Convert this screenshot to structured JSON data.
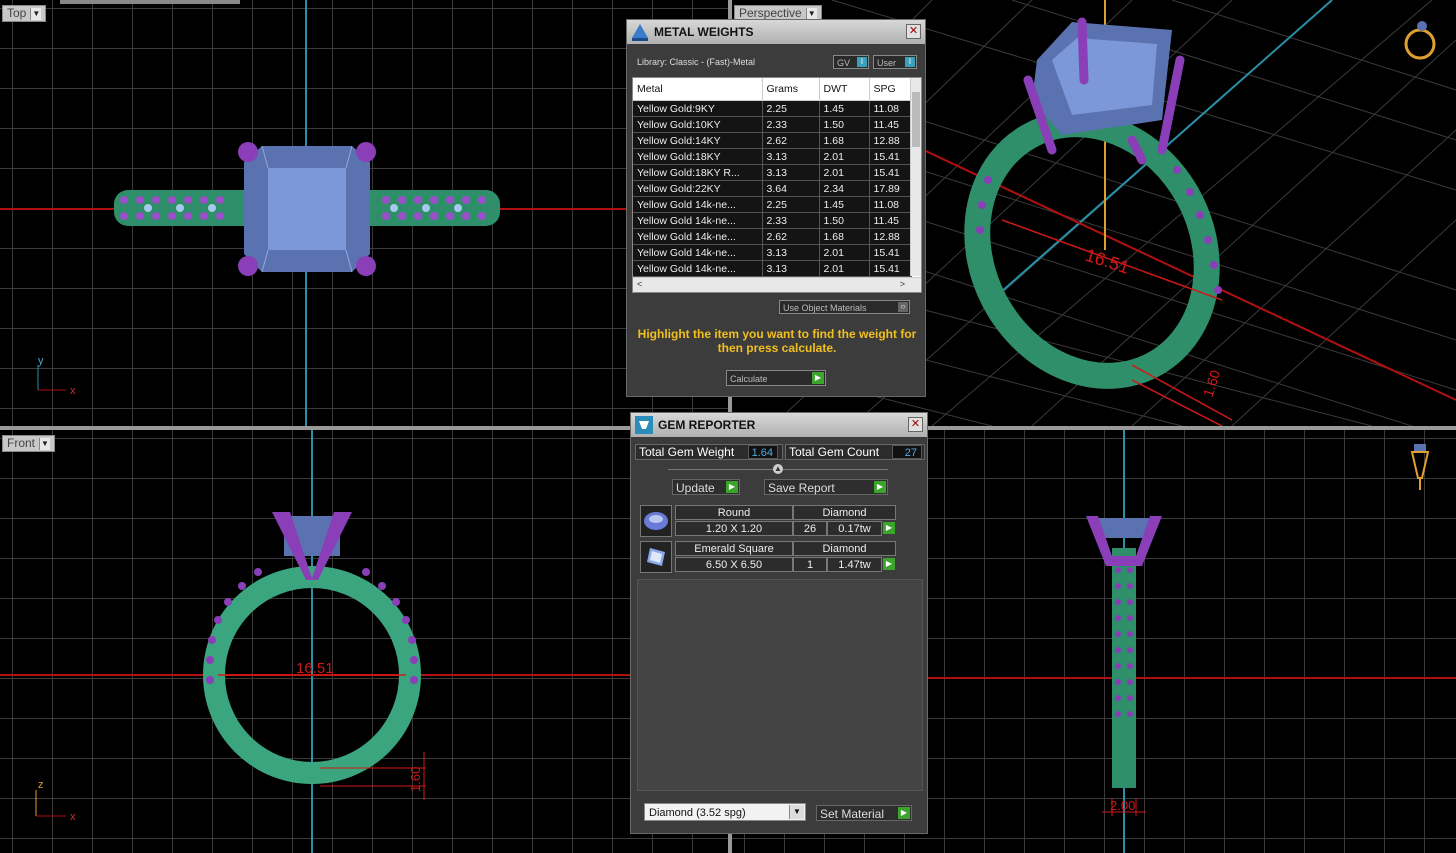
{
  "viewports": {
    "top": {
      "label": "Top",
      "axis_a": "y",
      "axis_b": "x"
    },
    "perspective": {
      "label": "Perspective",
      "dim_main": "16.51",
      "dim_small": "1.60"
    },
    "front": {
      "label": "Front",
      "dim_main": "16.51",
      "dim_small": "1.60",
      "axis_a": "z",
      "axis_b": "x"
    },
    "side": {
      "dim_main": "2.00"
    }
  },
  "metal_weights": {
    "title": "METAL WEIGHTS",
    "library": "Library: Classic - (Fast)-Metal",
    "gv_label": "GV",
    "user_label": "User",
    "columns": [
      "Metal",
      "Grams",
      "DWT",
      "SPG"
    ],
    "rows": [
      [
        "Yellow Gold:9KY",
        "2.25",
        "1.45",
        "11.08"
      ],
      [
        "Yellow Gold:10KY",
        "2.33",
        "1.50",
        "11.45"
      ],
      [
        "Yellow Gold:14KY",
        "2.62",
        "1.68",
        "12.88"
      ],
      [
        "Yellow Gold:18KY",
        "3.13",
        "2.01",
        "15.41"
      ],
      [
        "Yellow Gold:18KY R...",
        "3.13",
        "2.01",
        "15.41"
      ],
      [
        "Yellow Gold:22KY",
        "3.64",
        "2.34",
        "17.89"
      ],
      [
        "Yellow Gold 14k-ne...",
        "2.25",
        "1.45",
        "11.08"
      ],
      [
        "Yellow Gold 14k-ne...",
        "2.33",
        "1.50",
        "11.45"
      ],
      [
        "Yellow Gold 14k-ne...",
        "2.62",
        "1.68",
        "12.88"
      ],
      [
        "Yellow Gold 14k-ne...",
        "3.13",
        "2.01",
        "15.41"
      ],
      [
        "Yellow Gold 14k-ne...",
        "3.13",
        "2.01",
        "15.41"
      ]
    ],
    "use_object_materials": "Use Object Materials",
    "hint": "Highlight the item you want to find the weight for then press calculate.",
    "calculate_label": "Calculate"
  },
  "gem_reporter": {
    "title": "GEM REPORTER",
    "total_weight_label": "Total Gem Weight",
    "total_weight_value": "1.64",
    "total_count_label": "Total Gem Count",
    "total_count_value": "27",
    "update_label": "Update",
    "save_report_label": "Save Report",
    "gems": [
      {
        "shape": "Round",
        "material": "Diamond",
        "size": "1.20 X 1.20",
        "count": "26",
        "weight": "0.17tw",
        "icon": "round-gem-icon"
      },
      {
        "shape": "Emerald Square",
        "material": "Diamond",
        "size": "6.50 X 6.50",
        "count": "1",
        "weight": "1.47tw",
        "icon": "emerald-gem-icon"
      }
    ],
    "material_select": "Diamond     (3.52 spg)",
    "set_material_label": "Set Material"
  },
  "colors": {
    "band": "#2e8f6a",
    "prong": "#8a3fb8",
    "stone": "#6a88c8",
    "dimension": "#d01818",
    "axis": "#2a8fa8"
  }
}
